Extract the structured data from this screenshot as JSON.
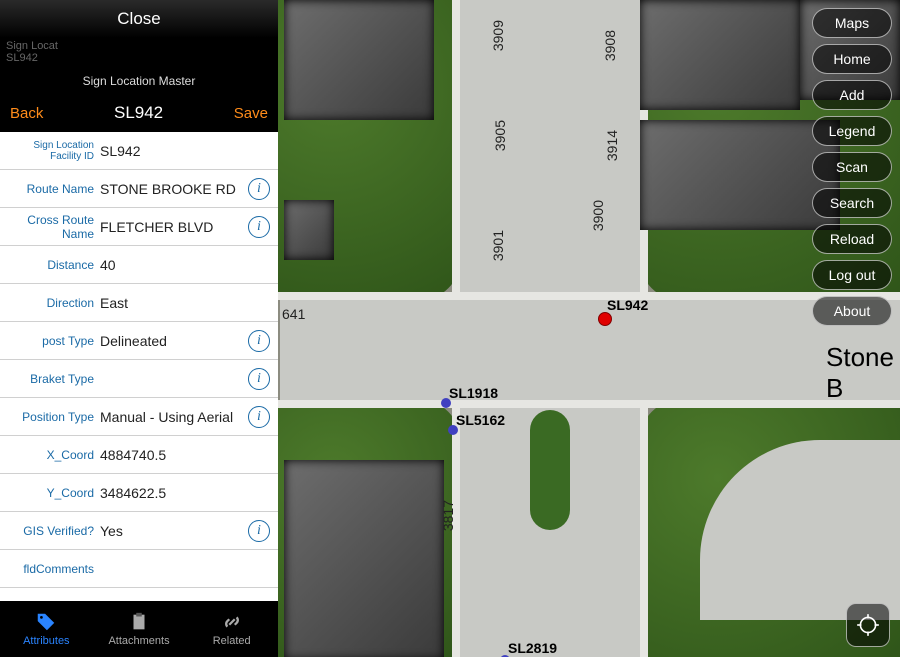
{
  "header": {
    "close": "Close",
    "master": "Sign Location Master",
    "back": "Back",
    "title": "SL942",
    "save": "Save",
    "dim_line1": "Sign Locat",
    "dim_line2": "SL942"
  },
  "fields": [
    {
      "label": "Sign Location Facility ID",
      "value": "SL942",
      "info": false,
      "small": true
    },
    {
      "label": "Route Name",
      "value": "STONE BROOKE RD",
      "info": true
    },
    {
      "label": "Cross Route Name",
      "value": "FLETCHER BLVD",
      "info": true
    },
    {
      "label": "Distance",
      "value": "40",
      "info": false
    },
    {
      "label": "Direction",
      "value": "East",
      "info": false
    },
    {
      "label": "post Type",
      "value": "Delineated",
      "info": true
    },
    {
      "label": "Braket Type",
      "value": "",
      "info": true
    },
    {
      "label": "Position Type",
      "value": "Manual - Using Aerial",
      "info": true
    },
    {
      "label": "X_Coord",
      "value": "4884740.5",
      "info": false
    },
    {
      "label": "Y_Coord",
      "value": "3484622.5",
      "info": false
    },
    {
      "label": "GIS Verified?",
      "value": "Yes",
      "info": true
    },
    {
      "label": "fldComments",
      "value": "",
      "info": false
    }
  ],
  "tabs": {
    "attributes": "Attributes",
    "attachments": "Attachments",
    "related": "Related"
  },
  "side_buttons": [
    "Maps",
    "Home",
    "Add",
    "Legend",
    "Scan",
    "Search",
    "Reload",
    "Log out",
    "About"
  ],
  "map": {
    "street_name": "Stone B",
    "house_numbers": {
      "n3909": "3909",
      "n3908": "3908",
      "n3905": "3905",
      "n3914": "3914",
      "n3900": "3900",
      "n3901": "3901",
      "n641": "641",
      "n3817": "3817"
    },
    "markers": {
      "sl942": "SL942",
      "sl1918": "SL1918",
      "sl5162": "SL5162",
      "sl2819": "SL2819"
    }
  }
}
